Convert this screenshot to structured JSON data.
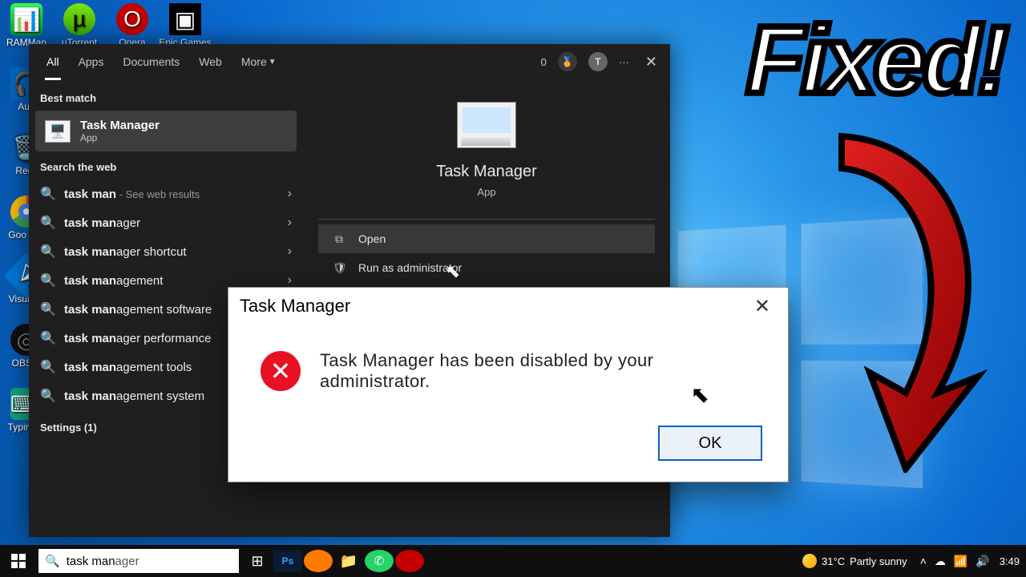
{
  "desktop_icons": {
    "row1": [
      "RAMMap",
      "µTorrent",
      "Opera Browser",
      "Epic Games Launcher"
    ],
    "col": [
      "Aud",
      "Recy",
      "Goo Chr",
      "Visual C",
      "OBS S",
      "Typing P"
    ]
  },
  "overlay": {
    "fixed_text": "Fixed!"
  },
  "search_panel": {
    "tabs": {
      "all": "All",
      "apps": "Apps",
      "documents": "Documents",
      "web": "Web",
      "more": "More"
    },
    "topbar": {
      "counter": "0",
      "avatar": "T",
      "ellipsis": "···",
      "close": "✕"
    },
    "best_match_label": "Best match",
    "best_match": {
      "title": "Task Manager",
      "subtitle": "App"
    },
    "web_label": "Search the web",
    "suggestions": [
      {
        "prefix": "task man",
        "suffix": "",
        "hint": " - See web results"
      },
      {
        "prefix": "task man",
        "suffix": "ager",
        "hint": ""
      },
      {
        "prefix": "task man",
        "suffix": "ager shortcut",
        "hint": ""
      },
      {
        "prefix": "task man",
        "suffix": "agement",
        "hint": ""
      },
      {
        "prefix": "task man",
        "suffix": "agement software",
        "hint": ""
      },
      {
        "prefix": "task man",
        "suffix": "ager performance",
        "hint": ""
      },
      {
        "prefix": "task man",
        "suffix": "agement tools",
        "hint": ""
      },
      {
        "prefix": "task man",
        "suffix": "agement system",
        "hint": ""
      }
    ],
    "settings_label": "Settings (1)",
    "right_pane": {
      "title": "Task Manager",
      "subtitle": "App",
      "actions": {
        "open": "Open",
        "runadmin": "Run as administrator"
      }
    }
  },
  "dialog": {
    "title": "Task Manager",
    "message": "Task Manager has been disabled by your administrator.",
    "ok": "OK",
    "close": "✕"
  },
  "taskbar": {
    "search_typed": "task man",
    "search_ghost": "ager",
    "weather_temp": "31°C",
    "weather_desc": "Partly sunny",
    "tray_chevron": "˄",
    "time": "3:49"
  }
}
